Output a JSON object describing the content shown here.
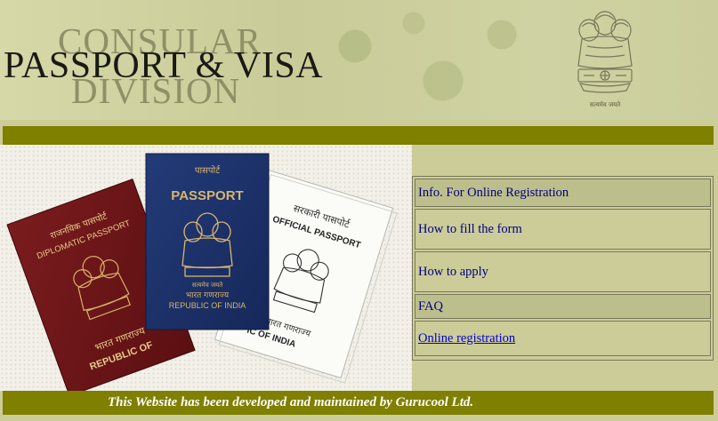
{
  "banner": {
    "line1": "CONSULAR",
    "line2": "PASSPORT & VISA",
    "line3": "DIVISION",
    "emblem_icon": "national-emblem-icon",
    "emblem_caption": "सत्यमेव जयते"
  },
  "photo": {
    "diplomatic": {
      "hindi": "राजनयिक पासपोर्ट",
      "title": "DIPLOMATIC PASSPORT",
      "hindi_bottom": "भारत गणराज्य",
      "country": "REPUBLIC OF"
    },
    "regular": {
      "hindi": "पासपोर्ट",
      "title": "PASSPORT",
      "motto": "सत्यमेव जयते",
      "hindi_bottom": "भारत गणराज्य",
      "country": "REPUBLIC OF INDIA"
    },
    "official": {
      "hindi": "सरकारी पासपोर्ट",
      "title": "OFFICIAL PASSPORT",
      "hindi_bottom": "भारत गणराज्य",
      "country": "IC OF INDIA"
    }
  },
  "menu": {
    "items": [
      {
        "label": "Info. For Online Registration"
      },
      {
        "label": "How to fill the form"
      },
      {
        "label": "How to apply"
      },
      {
        "label": "FAQ"
      },
      {
        "label": "Online registration"
      }
    ]
  },
  "footer": {
    "text": "This Website has been developed and maintained by Gurucool Ltd."
  },
  "colors": {
    "background": "#cccc99",
    "olive_bar": "#7f7f00",
    "link": "#0000cc",
    "menu_text": "#000080"
  }
}
